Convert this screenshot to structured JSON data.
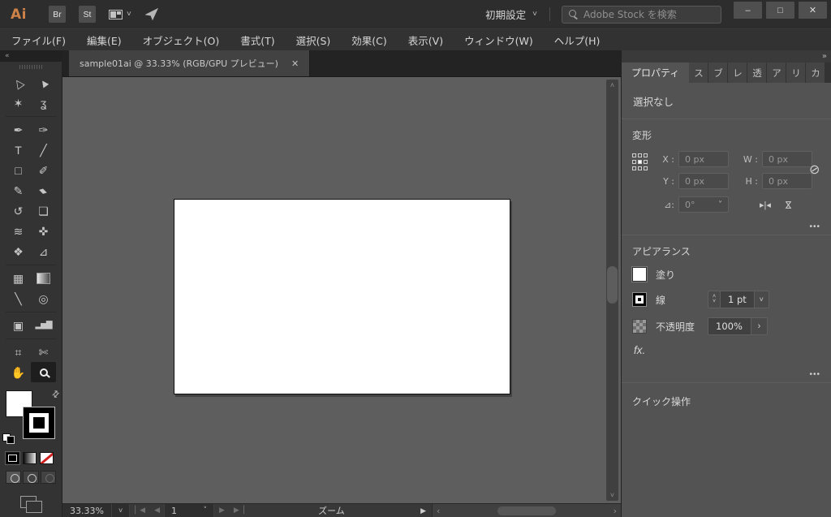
{
  "titlebar": {
    "logo": "Ai",
    "bridge": "Br",
    "stock": "St",
    "workspace": "初期設定",
    "search_placeholder": "Adobe Stock を検索"
  },
  "menubar": {
    "items": [
      "ファイル(F)",
      "編集(E)",
      "オブジェクト(O)",
      "書式(T)",
      "選択(S)",
      "効果(C)",
      "表示(V)",
      "ウィンドウ(W)",
      "ヘルプ(H)"
    ]
  },
  "document_tab": {
    "title": "sample01ai @ 33.33% (RGB/GPU プレビュー)",
    "close": "✕"
  },
  "tools": {
    "items": [
      {
        "name": "selection",
        "glyph": "△"
      },
      {
        "name": "direct-selection",
        "glyph": "▲"
      },
      {
        "name": "magic-wand",
        "glyph": "✶"
      },
      {
        "name": "lasso",
        "glyph": "ʓ"
      },
      {
        "name": "pen",
        "glyph": "✒"
      },
      {
        "name": "curvature",
        "glyph": "✑"
      },
      {
        "name": "type",
        "glyph": "T"
      },
      {
        "name": "line-segment",
        "glyph": "╱"
      },
      {
        "name": "rectangle",
        "glyph": "□"
      },
      {
        "name": "paintbrush",
        "glyph": "✐"
      },
      {
        "name": "shaper",
        "glyph": "✎"
      },
      {
        "name": "eraser",
        "glyph": "▰"
      },
      {
        "name": "rotate",
        "glyph": "↺"
      },
      {
        "name": "scale",
        "glyph": "❏"
      },
      {
        "name": "width",
        "glyph": "≋"
      },
      {
        "name": "puppet-warp",
        "glyph": "✜"
      },
      {
        "name": "shape-builder",
        "glyph": "❖"
      },
      {
        "name": "perspective-grid",
        "glyph": "⊿"
      },
      {
        "name": "mesh",
        "glyph": "▦"
      },
      {
        "name": "gradient",
        "glyph": ""
      },
      {
        "name": "eyedropper",
        "glyph": "╲"
      },
      {
        "name": "blend",
        "glyph": "◎"
      },
      {
        "name": "symbol-sprayer",
        "glyph": "▣"
      },
      {
        "name": "graph",
        "glyph": "▂▅▇"
      },
      {
        "name": "artboard",
        "glyph": "⌗"
      },
      {
        "name": "slice",
        "glyph": "✄"
      },
      {
        "name": "hand",
        "glyph": "✋"
      },
      {
        "name": "zoom",
        "glyph": ""
      }
    ]
  },
  "statusbar": {
    "zoom_value": "33.33%",
    "page_value": "1",
    "tool_label": "ズーム"
  },
  "right_panel": {
    "tabs_active": "プロパティ",
    "small_tabs": [
      "ス",
      "ブ",
      "レ",
      "透",
      "ア",
      "リ",
      "カ"
    ],
    "no_selection": "選択なし",
    "transform": {
      "title": "変形",
      "x_label": "X :",
      "x_value": "0 px",
      "y_label": "Y :",
      "y_value": "0 px",
      "w_label": "W :",
      "w_value": "0 px",
      "h_label": "H :",
      "h_value": "0 px",
      "angle_label": "⊿:",
      "angle_value": "0°"
    },
    "appearance": {
      "title": "アピアランス",
      "fill_label": "塗り",
      "stroke_label": "線",
      "stroke_width": "1 pt",
      "opacity_label": "不透明度",
      "opacity_value": "100%",
      "fx_label": "fx."
    },
    "quick_actions": {
      "title": "クイック操作"
    }
  },
  "icons": {
    "collapse": "«",
    "expand": "»",
    "chevron_down": "˅",
    "caret_up": "˄",
    "caret_down": "˅",
    "minimize": "–",
    "maximize": "□",
    "close": "✕",
    "more": "•••",
    "first": "▏◀",
    "prev": "◀",
    "next": "▶",
    "last": "▶▕",
    "play": "▶",
    "hleft": "‹",
    "hright": "›",
    "vup": "˄",
    "vdown": "˅",
    "flip_h": "▸|◂",
    "flip_v": "⋈",
    "link": "⊘",
    "swap": "⇄",
    "opacity_more": "›"
  },
  "colors": {
    "accent_orange": "#CE8247",
    "canvas_gray": "#5E5E5E",
    "panel_gray": "#535353",
    "artboard_white": "#FFFFFF"
  }
}
